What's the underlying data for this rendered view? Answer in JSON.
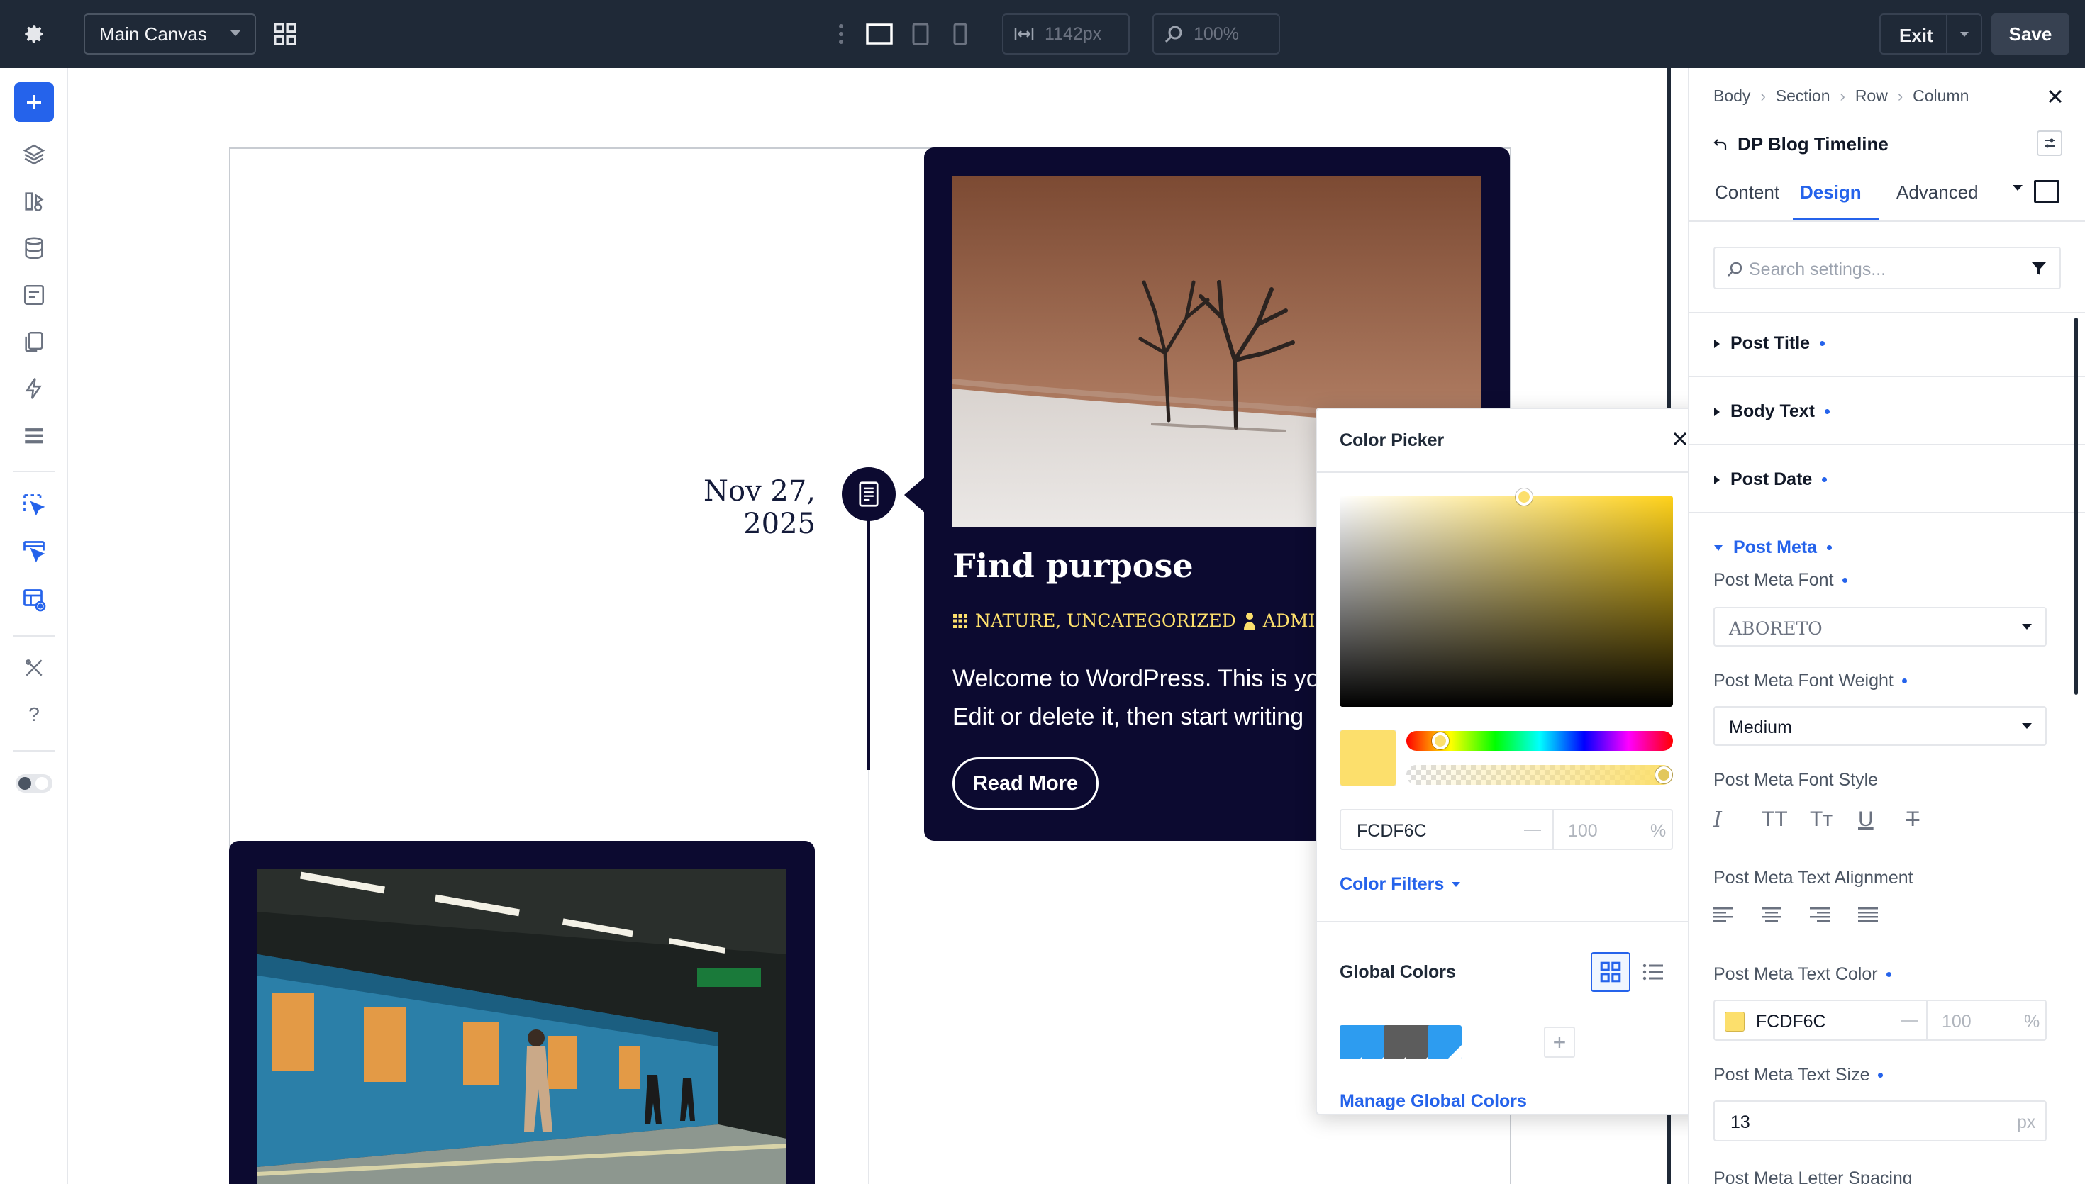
{
  "topbar": {
    "canvas_select": "Main Canvas",
    "width_value": "1142px",
    "zoom_value": "100%",
    "exit_label": "Exit",
    "save_label": "Save"
  },
  "canvas": {
    "post_date": "Nov 27, 2025",
    "post_title": "Find purpose",
    "post_meta_categories": "NATURE, UNCATEGORIZED",
    "post_meta_author": "ADMIN",
    "post_body_line1": "Welcome to WordPress. This is yo",
    "post_body_line2": "Edit or delete it, then start writing",
    "read_more_label": "Read More"
  },
  "color_picker": {
    "title": "Color Picker",
    "hex_value": "FCDF6C",
    "opacity_placeholder": "100",
    "opacity_unit": "%",
    "filters_label": "Color Filters",
    "global_colors_label": "Global Colors",
    "manage_label": "Manage Global Colors",
    "selected_color": "#fcdf6c",
    "global_swatches": [
      "#2d9cf0",
      "#2d9cf0",
      "#5c5c5c",
      "#5c5c5c",
      "#2d9cf0"
    ]
  },
  "panel": {
    "breadcrumb": [
      "Body",
      "Section",
      "Row",
      "Column"
    ],
    "module_title": "DP Blog Timeline",
    "tabs": [
      "Content",
      "Design",
      "Advanced"
    ],
    "active_tab": "Design",
    "search_placeholder": "Search settings...",
    "groups": {
      "post_title": "Post Title",
      "body_text": "Body Text",
      "post_date": "Post Date",
      "post_meta": "Post Meta"
    },
    "fields": {
      "font_label": "Post Meta Font",
      "font_value": "ABORETO",
      "weight_label": "Post Meta Font Weight",
      "weight_value": "Medium",
      "style_label": "Post Meta Font Style",
      "align_label": "Post Meta Text Alignment",
      "color_label": "Post Meta Text Color",
      "color_value": "FCDF6C",
      "color_opacity": "100",
      "color_unit": "%",
      "size_label": "Post Meta Text Size",
      "size_value": "13",
      "size_unit": "px",
      "spacing_label": "Post Meta Letter Spacing"
    },
    "style_glyphs": [
      "I",
      "TT",
      "Tт",
      "U",
      "T"
    ]
  }
}
